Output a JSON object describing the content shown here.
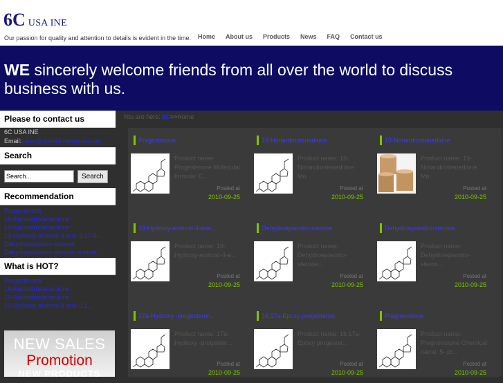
{
  "header": {
    "logo_big": "6C",
    "logo_small": "USA INE",
    "tagline": "Our passion for quality and attention to details is evident in the time.",
    "nav": [
      "Home",
      "About us",
      "Products",
      "News",
      "FAQ",
      "Contact us"
    ]
  },
  "banner": {
    "lead": "WE",
    "text": "sincerely welcome friends from all over the world to discuss business with us."
  },
  "sidebar": {
    "contact": {
      "heading": "Please to contact us",
      "company": "6C USA INE",
      "email_label": "Email:",
      "email": "sales@steroid-hormones.net"
    },
    "search": {
      "heading": "Search",
      "input_value": "Search...",
      "button": "Search"
    },
    "recommendation": {
      "heading": "Recommendation",
      "items": [
        "Progesterone",
        "19-Norandrostenedione",
        "19-Norandrostenedione",
        "19-Hydroxy-androst-4-ene-3,17-di...",
        "Dehydroepiandro-sterone",
        "Dehydroepiandro-sterone acetate"
      ]
    },
    "hot": {
      "heading": "What is HOT?",
      "items": [
        "Progesterone",
        "19-Norandrostenedione",
        "19-Norandrostenedione",
        "19-Hydroxy-androst-4-ene-3,1..."
      ]
    },
    "promo": {
      "line1": "NEW SALES",
      "line2": "Promotion",
      "line3": "NEW PRODUCTS"
    }
  },
  "breadcrumb": {
    "prefix": "You are here:",
    "home_link": "6C",
    "separator": ">>",
    "current": "Home"
  },
  "products": [
    {
      "title": "Progesterone",
      "desc": "Product name: Progesterone Molecular formula: C...",
      "posted": "Posted at",
      "date": "2010-09-25",
      "image": "molecule-structure"
    },
    {
      "title": "19-Norandrostenedione",
      "desc": "Product name: 19-Norandrostenedione Mo...",
      "posted": "Posted at",
      "date": "2010-09-25",
      "image": "molecule-structure"
    },
    {
      "title": "19-Norandrostenedione",
      "desc": "Product name: 19-Norandrostenedione Mo...",
      "posted": "Posted at",
      "date": "2010-09-25",
      "image": "product-drums-photo"
    },
    {
      "title": "19-Hydroxy-androst-4-ene..",
      "desc": "Product name: 19-Hydroxy-androst-4-e...",
      "posted": "Posted at",
      "date": "2010-09-25",
      "image": "molecule-structure"
    },
    {
      "title": "Dehydroepiandro-sterone",
      "desc": "Product name: Dehydroepiandro-sterone...",
      "posted": "Posted at",
      "date": "2010-09-25",
      "image": "molecule-structure"
    },
    {
      "title": "Dehydroepiandro-sterone ..",
      "desc": "Product name: Dehydroepiandro-steron...",
      "posted": "Posted at",
      "date": "2010-09-25",
      "image": "molecule-structure"
    },
    {
      "title": "17a-Hydroxy -progesteron..",
      "desc": "Product name: 17a-Hydroxy -progester...",
      "posted": "Posted at",
      "date": "2010-09-25",
      "image": "molecule-structure"
    },
    {
      "title": "16,17a-Epoxy progesteron..",
      "desc": "Product name: 16,17a-Epoxy progester...",
      "posted": "Posted at",
      "date": "2010-09-25",
      "image": "molecule-structure"
    },
    {
      "title": "Pregnenolone",
      "desc": "Product name: Pregnenolone Chemical name: 5- pr...",
      "posted": "Posted at",
      "date": "2010-09-25",
      "image": "molecule-structure"
    }
  ],
  "colors": {
    "banner_bg": "#0d0c62",
    "accent_green": "#7fc400",
    "link_blue": "#2a2ad6",
    "page_bg": "#2f2f2f"
  }
}
